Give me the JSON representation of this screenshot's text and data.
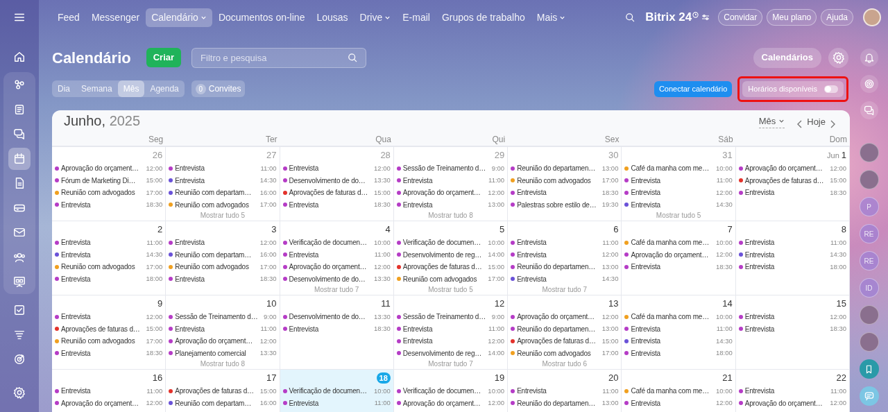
{
  "top_nav": {
    "items": [
      {
        "label": "Feed",
        "selected": false,
        "has_menu": false
      },
      {
        "label": "Messenger",
        "selected": false,
        "has_menu": false
      },
      {
        "label": "Calendário",
        "selected": true,
        "has_menu": true
      },
      {
        "label": "Documentos on-line",
        "selected": false,
        "has_menu": false
      },
      {
        "label": "Lousas",
        "selected": false,
        "has_menu": false
      },
      {
        "label": "Drive",
        "selected": false,
        "has_menu": true
      },
      {
        "label": "E-mail",
        "selected": false,
        "has_menu": false
      },
      {
        "label": "Grupos de trabalho",
        "selected": false,
        "has_menu": false
      },
      {
        "label": "Mais",
        "selected": false,
        "has_menu": true
      }
    ],
    "logo": {
      "name": "Bitrix",
      "suffix": "24"
    },
    "buttons": [
      "Convidar",
      "Meu plano",
      "Ajuda"
    ]
  },
  "sidebar": {
    "top": [
      {
        "kind": "home",
        "selected": false
      }
    ],
    "pinned": [
      {
        "kind": "flow",
        "selected": false
      },
      {
        "kind": "news",
        "selected": false
      },
      {
        "kind": "chat",
        "selected": false
      },
      {
        "kind": "calendar",
        "selected": true
      },
      {
        "kind": "doc",
        "selected": false
      },
      {
        "kind": "drive",
        "selected": false
      },
      {
        "kind": "mail",
        "selected": false
      },
      {
        "kind": "contacts",
        "selected": false
      },
      {
        "kind": "board",
        "selected": false
      }
    ],
    "more": [
      {
        "kind": "tasks",
        "selected": false
      },
      {
        "kind": "funnel",
        "selected": false
      },
      {
        "kind": "target",
        "selected": false
      }
    ],
    "bottom": [
      {
        "kind": "settings",
        "selected": false
      }
    ]
  },
  "toolbar": {
    "title": "Calendário",
    "create_button": "Criar",
    "search": {
      "placeholder": "Filtro e pesquisa"
    },
    "calendars_button": "Calendários",
    "views": [
      {
        "label": "Dia",
        "selected": false
      },
      {
        "label": "Semana",
        "selected": false
      },
      {
        "label": "Mês",
        "selected": true
      },
      {
        "label": "Agenda",
        "selected": false
      }
    ],
    "invites": {
      "count": "0",
      "label": "Convites"
    },
    "connect_button": "Conectar calendário",
    "availability": {
      "label": "Horários disponíveis",
      "on": false,
      "highlighted": true
    }
  },
  "right_rail": {
    "icons": [
      {
        "kind": "bell"
      },
      {
        "kind": "spiral"
      },
      {
        "kind": "chat"
      }
    ],
    "avatars": [
      {
        "kind": "photo"
      },
      {
        "kind": "photo"
      },
      {
        "kind": "initials",
        "initials": "P"
      },
      {
        "kind": "initials",
        "initials": "RE"
      },
      {
        "kind": "initials",
        "initials": "RE"
      },
      {
        "kind": "initials",
        "initials": "ID"
      },
      {
        "kind": "photo"
      },
      {
        "kind": "photo"
      },
      {
        "kind": "bookmark"
      },
      {
        "kind": "message"
      }
    ]
  },
  "calendar": {
    "month": "Junho,",
    "year": "2025",
    "view": "Mês",
    "today_label": "Hoje",
    "weekdays": [
      "Seg",
      "Ter",
      "Qua",
      "Qui",
      "Sex",
      "Sáb",
      "Dom"
    ],
    "weeks": [
      {
        "days": [
          {
            "number": "26",
            "outside_month": true,
            "today": false,
            "events": [
              {
                "title": "Aprovação do orçament…",
                "time": "12:00",
                "color": "#b53cc6"
              },
              {
                "title": "Fórum de Marketing Di…",
                "time": "15:00",
                "color": "#b53cc6"
              },
              {
                "title": "Reunião com advogados",
                "time": "17:00",
                "color": "#f0a020"
              },
              {
                "title": "Entrevista",
                "time": "18:30",
                "color": "#b53cc6"
              }
            ]
          },
          {
            "number": "27",
            "outside_month": true,
            "today": false,
            "events": [
              {
                "title": "Entrevista",
                "time": "11:00",
                "color": "#b53cc6"
              },
              {
                "title": "Entrevista",
                "time": "14:30",
                "color": "#6a52d8"
              },
              {
                "title": "Reunião com departam…",
                "time": "16:00",
                "color": "#6a52d8"
              },
              {
                "title": "Reunião com advogados",
                "time": "17:00",
                "color": "#f0a020"
              }
            ],
            "more": "Mostrar tudo 5"
          },
          {
            "number": "28",
            "outside_month": true,
            "today": false,
            "events": [
              {
                "title": "Entrevista",
                "time": "12:00",
                "color": "#b53cc6"
              },
              {
                "title": "Desenvolvimento de do…",
                "time": "13:30",
                "color": "#b53cc6"
              },
              {
                "title": "Aprovações de faturas d…",
                "time": "15:00",
                "color": "#e3322b"
              },
              {
                "title": "Entrevista",
                "time": "18:30",
                "color": "#b53cc6"
              }
            ]
          },
          {
            "number": "29",
            "outside_month": true,
            "today": false,
            "events": [
              {
                "title": "Sessão de Treinamento d…",
                "time": "9:00",
                "color": "#b53cc6"
              },
              {
                "title": "Entrevista",
                "time": "11:00",
                "color": "#b53cc6"
              },
              {
                "title": "Aprovação do orçament…",
                "time": "12:00",
                "color": "#b53cc6"
              },
              {
                "title": "Entrevista",
                "time": "13:00",
                "color": "#b53cc6"
              }
            ],
            "more": "Mostrar tudo 8"
          },
          {
            "number": "30",
            "outside_month": true,
            "today": false,
            "events": [
              {
                "title": "Reunião do departamen…",
                "time": "13:00",
                "color": "#b53cc6"
              },
              {
                "title": "Reunião com advogados",
                "time": "17:00",
                "color": "#f0a020"
              },
              {
                "title": "Entrevista",
                "time": "18:30",
                "color": "#b53cc6"
              },
              {
                "title": "Palestras sobre estilo de…",
                "time": "19:30",
                "color": "#b53cc6"
              }
            ]
          },
          {
            "number": "31",
            "outside_month": true,
            "today": false,
            "events": [
              {
                "title": "Café da manha com me…",
                "time": "10:00",
                "color": "#f0a020"
              },
              {
                "title": "Entrevista",
                "time": "11:00",
                "color": "#b53cc6"
              },
              {
                "title": "Entrevista",
                "time": "12:00",
                "color": "#b53cc6"
              },
              {
                "title": "Entrevista",
                "time": "14:30",
                "color": "#6a52d8"
              }
            ],
            "more": "Mostrar tudo 5"
          },
          {
            "prefix": "Jun",
            "number": "1",
            "outside_month": false,
            "today": false,
            "events": [
              {
                "title": "Aprovação do orçament…",
                "time": "12:00",
                "color": "#b53cc6"
              },
              {
                "title": "Aprovações de faturas d…",
                "time": "15:00",
                "color": "#e3322b"
              },
              {
                "title": "Entrevista",
                "time": "18:30",
                "color": "#b53cc6"
              }
            ]
          }
        ]
      },
      {
        "days": [
          {
            "number": "2",
            "outside_month": false,
            "today": false,
            "events": [
              {
                "title": "Entrevista",
                "time": "11:00",
                "color": "#b53cc6"
              },
              {
                "title": "Entrevista",
                "time": "14:30",
                "color": "#6a52d8"
              },
              {
                "title": "Reunião com advogados",
                "time": "17:00",
                "color": "#f0a020"
              },
              {
                "title": "Entrevista",
                "time": "18:00",
                "color": "#b53cc6"
              }
            ]
          },
          {
            "number": "3",
            "outside_month": false,
            "today": false,
            "events": [
              {
                "title": "Entrevista",
                "time": "12:00",
                "color": "#b53cc6"
              },
              {
                "title": "Reunião com departam…",
                "time": "16:00",
                "color": "#6a52d8"
              },
              {
                "title": "Reunião com advogados",
                "time": "17:00",
                "color": "#f0a020"
              },
              {
                "title": "Entrevista",
                "time": "18:30",
                "color": "#b53cc6"
              }
            ]
          },
          {
            "number": "4",
            "outside_month": false,
            "today": false,
            "events": [
              {
                "title": "Verificação de documen…",
                "time": "10:00",
                "color": "#b53cc6"
              },
              {
                "title": "Entrevista",
                "time": "11:00",
                "color": "#b53cc6"
              },
              {
                "title": "Aprovação do orçament…",
                "time": "12:00",
                "color": "#b53cc6"
              },
              {
                "title": "Desenvolvimento de do…",
                "time": "13:30",
                "color": "#b53cc6"
              }
            ],
            "more": "Mostrar tudo 7"
          },
          {
            "number": "5",
            "outside_month": false,
            "today": false,
            "events": [
              {
                "title": "Verificação de documen…",
                "time": "10:00",
                "color": "#b53cc6"
              },
              {
                "title": "Desenvolvimento de reg…",
                "time": "14:00",
                "color": "#b53cc6"
              },
              {
                "title": "Aprovações de faturas d…",
                "time": "15:00",
                "color": "#e3322b"
              },
              {
                "title": "Reunião com advogados",
                "time": "17:00",
                "color": "#f0a020"
              }
            ],
            "more": "Mostrar tudo 5"
          },
          {
            "number": "6",
            "outside_month": false,
            "today": false,
            "events": [
              {
                "title": "Entrevista",
                "time": "11:00",
                "color": "#b53cc6"
              },
              {
                "title": "Entrevista",
                "time": "12:00",
                "color": "#b53cc6"
              },
              {
                "title": "Reunião do departamen…",
                "time": "13:00",
                "color": "#b53cc6"
              },
              {
                "title": "Entrevista",
                "time": "14:30",
                "color": "#6a52d8"
              }
            ],
            "more": "Mostrar tudo 7"
          },
          {
            "number": "7",
            "outside_month": false,
            "today": false,
            "events": [
              {
                "title": "Café da manha com me…",
                "time": "10:00",
                "color": "#f0a020"
              },
              {
                "title": "Aprovação do orçament…",
                "time": "12:00",
                "color": "#b53cc6"
              },
              {
                "title": "Entrevista",
                "time": "18:30",
                "color": "#b53cc6"
              }
            ]
          },
          {
            "number": "8",
            "outside_month": false,
            "today": false,
            "events": [
              {
                "title": "Entrevista",
                "time": "11:00",
                "color": "#b53cc6"
              },
              {
                "title": "Entrevista",
                "time": "14:30",
                "color": "#6a52d8"
              },
              {
                "title": "Entrevista",
                "time": "18:00",
                "color": "#b53cc6"
              }
            ]
          }
        ]
      },
      {
        "days": [
          {
            "number": "9",
            "outside_month": false,
            "today": false,
            "events": [
              {
                "title": "Entrevista",
                "time": "12:00",
                "color": "#b53cc6"
              },
              {
                "title": "Aprovações de faturas d…",
                "time": "15:00",
                "color": "#e3322b"
              },
              {
                "title": "Reunião com advogados",
                "time": "17:00",
                "color": "#f0a020"
              },
              {
                "title": "Entrevista",
                "time": "18:30",
                "color": "#b53cc6"
              }
            ]
          },
          {
            "number": "10",
            "outside_month": false,
            "today": false,
            "events": [
              {
                "title": "Sessão de Treinamento d…",
                "time": "9:00",
                "color": "#b53cc6"
              },
              {
                "title": "Entrevista",
                "time": "11:00",
                "color": "#b53cc6"
              },
              {
                "title": "Aprovação do orçament…",
                "time": "12:00",
                "color": "#b53cc6"
              },
              {
                "title": "Planejamento comercial",
                "time": "13:30",
                "color": "#b53cc6"
              }
            ],
            "more": "Mostrar tudo 8"
          },
          {
            "number": "11",
            "outside_month": false,
            "today": false,
            "events": [
              {
                "title": "Desenvolvimento de do…",
                "time": "13:30",
                "color": "#b53cc6"
              },
              {
                "title": "Entrevista",
                "time": "18:30",
                "color": "#b53cc6"
              }
            ]
          },
          {
            "number": "12",
            "outside_month": false,
            "today": false,
            "events": [
              {
                "title": "Sessão de Treinamento d…",
                "time": "9:00",
                "color": "#b53cc6"
              },
              {
                "title": "Entrevista",
                "time": "11:00",
                "color": "#b53cc6"
              },
              {
                "title": "Entrevista",
                "time": "12:00",
                "color": "#b53cc6"
              },
              {
                "title": "Desenvolvimento de reg…",
                "time": "14:00",
                "color": "#b53cc6"
              }
            ],
            "more": "Mostrar tudo 7"
          },
          {
            "number": "13",
            "outside_month": false,
            "today": false,
            "events": [
              {
                "title": "Aprovação do orçament…",
                "time": "12:00",
                "color": "#b53cc6"
              },
              {
                "title": "Reunião do departamen…",
                "time": "13:00",
                "color": "#b53cc6"
              },
              {
                "title": "Aprovações de faturas d…",
                "time": "15:00",
                "color": "#e3322b"
              },
              {
                "title": "Reunião com advogados",
                "time": "17:00",
                "color": "#f0a020"
              }
            ],
            "more": "Mostrar tudo 6"
          },
          {
            "number": "14",
            "outside_month": false,
            "today": false,
            "events": [
              {
                "title": "Café da manha com me…",
                "time": "10:00",
                "color": "#f0a020"
              },
              {
                "title": "Entrevista",
                "time": "11:00",
                "color": "#b53cc6"
              },
              {
                "title": "Entrevista",
                "time": "14:30",
                "color": "#6a52d8"
              },
              {
                "title": "Entrevista",
                "time": "18:00",
                "color": "#b53cc6"
              }
            ]
          },
          {
            "number": "15",
            "outside_month": false,
            "today": false,
            "events": [
              {
                "title": "Entrevista",
                "time": "12:00",
                "color": "#b53cc6"
              },
              {
                "title": "Entrevista",
                "time": "18:30",
                "color": "#b53cc6"
              }
            ]
          }
        ]
      },
      {
        "days": [
          {
            "number": "16",
            "outside_month": false,
            "today": false,
            "events": [
              {
                "title": "Entrevista",
                "time": "11:00",
                "color": "#b53cc6"
              },
              {
                "title": "Aprovação do orçament…",
                "time": "12:00",
                "color": "#b53cc6"
              }
            ]
          },
          {
            "number": "17",
            "outside_month": false,
            "today": false,
            "events": [
              {
                "title": "Aprovações de faturas d…",
                "time": "15:00",
                "color": "#e3322b"
              },
              {
                "title": "Reunião com departam…",
                "time": "16:00",
                "color": "#6a52d8"
              }
            ]
          },
          {
            "number": "18",
            "outside_month": false,
            "today": true,
            "events": [
              {
                "title": "Verificação de documen…",
                "time": "10:00",
                "color": "#b53cc6"
              },
              {
                "title": "Entrevista",
                "time": "11:00",
                "color": "#b53cc6"
              }
            ]
          },
          {
            "number": "19",
            "outside_month": false,
            "today": false,
            "events": [
              {
                "title": "Verificação de documen…",
                "time": "10:00",
                "color": "#b53cc6"
              },
              {
                "title": "Aprovação do orçament…",
                "time": "12:00",
                "color": "#b53cc6"
              }
            ]
          },
          {
            "number": "20",
            "outside_month": false,
            "today": false,
            "events": [
              {
                "title": "Entrevista",
                "time": "11:00",
                "color": "#b53cc6"
              },
              {
                "title": "Reunião do departamen…",
                "time": "13:00",
                "color": "#b53cc6"
              }
            ]
          },
          {
            "number": "21",
            "outside_month": false,
            "today": false,
            "events": [
              {
                "title": "Café da manha com me…",
                "time": "10:00",
                "color": "#f0a020"
              },
              {
                "title": "Entrevista",
                "time": "12:00",
                "color": "#b53cc6"
              }
            ]
          },
          {
            "number": "22",
            "outside_month": false,
            "today": false,
            "events": [
              {
                "title": "Entrevista",
                "time": "11:00",
                "color": "#b53cc6"
              },
              {
                "title": "Aprovação do orçament…",
                "time": "12:00",
                "color": "#b53cc6"
              }
            ]
          }
        ]
      }
    ]
  }
}
